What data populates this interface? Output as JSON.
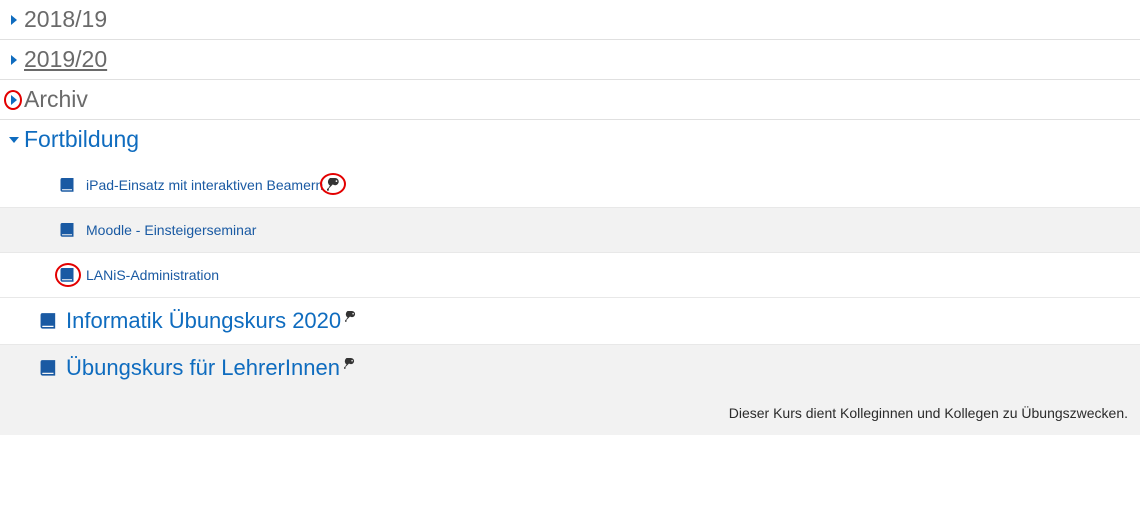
{
  "categories": [
    {
      "label": "2018/19",
      "expanded": false,
      "style": "gray"
    },
    {
      "label": "2019/20",
      "expanded": false,
      "style": "link"
    },
    {
      "label": "Archiv",
      "expanded": false,
      "style": "gray",
      "caret_circled": true
    },
    {
      "label": "Fortbildung",
      "expanded": true,
      "style": "blue"
    }
  ],
  "fortbildung_courses": [
    {
      "title": "iPad-Einsatz mit interaktiven Beamern",
      "has_key": true,
      "key_circled": true,
      "icon_circled": false,
      "row": "odd"
    },
    {
      "title": "Moodle - Einsteigerseminar",
      "has_key": false,
      "key_circled": false,
      "icon_circled": false,
      "row": "even"
    },
    {
      "title": "LANiS-Administration",
      "has_key": false,
      "key_circled": false,
      "icon_circled": true,
      "row": "odd"
    }
  ],
  "large_courses": [
    {
      "title": "Informatik Übungskurs 2020",
      "has_key": true,
      "bg": false
    },
    {
      "title": "Übungskurs für LehrerInnen",
      "has_key": true,
      "bg": true,
      "description": "Dieser Kurs dient Kolleginnen und Kollegen zu Übungszwecken."
    }
  ]
}
